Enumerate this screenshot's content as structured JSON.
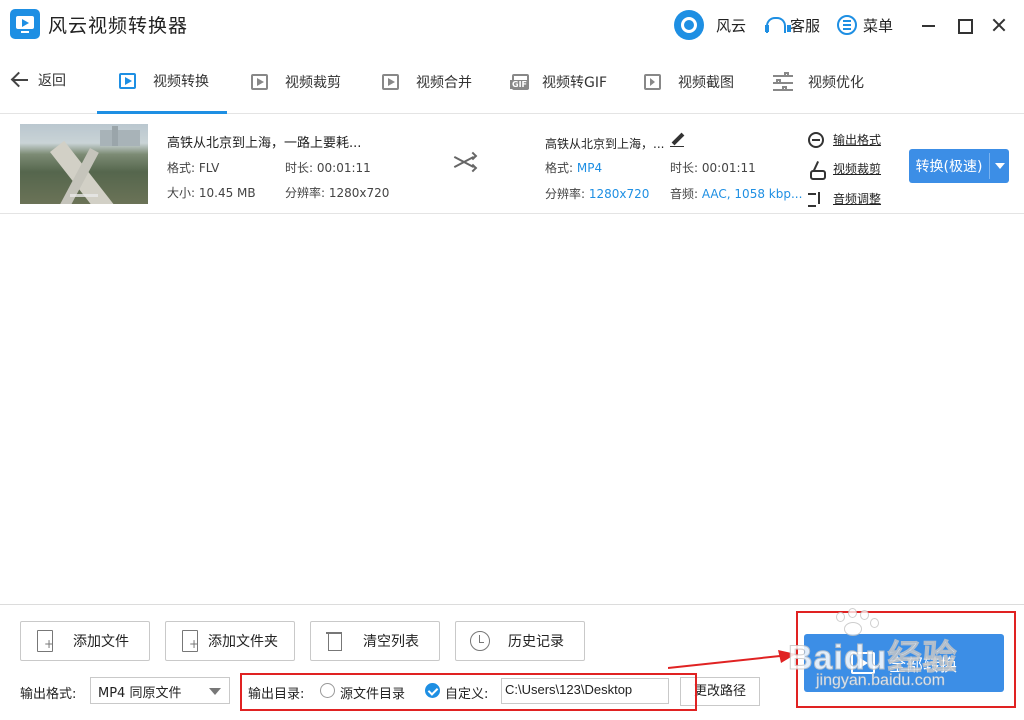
{
  "app": {
    "title": "风云视频转换器"
  },
  "titlebar": {
    "user": "风云",
    "service": "客服",
    "menu": "菜单"
  },
  "nav": {
    "back": "返回",
    "tabs": [
      "视频转换",
      "视频裁剪",
      "视频合并",
      "视频转GIF",
      "视频截图",
      "视频优化"
    ],
    "active_tab": "视频转换"
  },
  "file": {
    "source": {
      "name": "高铁从北京到上海，一路上要耗...",
      "format_label": "格式:",
      "format": "FLV",
      "duration_label": "时长:",
      "duration": "00:01:11",
      "size_label": "大小:",
      "size": "10.45 MB",
      "resolution_label": "分辨率:",
      "resolution": "1280x720"
    },
    "output": {
      "name": "高铁从北京到上海，...",
      "format_label": "格式:",
      "format": "MP4",
      "duration_label": "时长:",
      "duration": "00:01:11",
      "resolution_label": "分辨率:",
      "resolution": "1280x720",
      "audio_label": "音频:",
      "audio": "AAC, 1058 kbp..."
    },
    "links": {
      "output_format": "输出格式",
      "video_cut": "视频裁剪",
      "audio_adjust": "音频调整"
    },
    "convert_button": "转换(极速)"
  },
  "bottom": {
    "add_file": "添加文件",
    "add_folder": "添加文件夹",
    "clear_list": "清空列表",
    "history": "历史记录",
    "output_format_label": "输出格式:",
    "output_format_value": "MP4 同原文件",
    "output_dir_label": "输出目录:",
    "source_dir_option": "源文件目录",
    "custom_option": "自定义:",
    "custom_path": "C:\\Users\\123\\Desktop",
    "change_path": "更改路径",
    "convert_all": "全部转换"
  },
  "watermark": {
    "brand": "Baidu经验",
    "url": "jingyan.baidu.com"
  },
  "colors": {
    "accent": "#3c8ee6",
    "highlight": "#e02222"
  }
}
